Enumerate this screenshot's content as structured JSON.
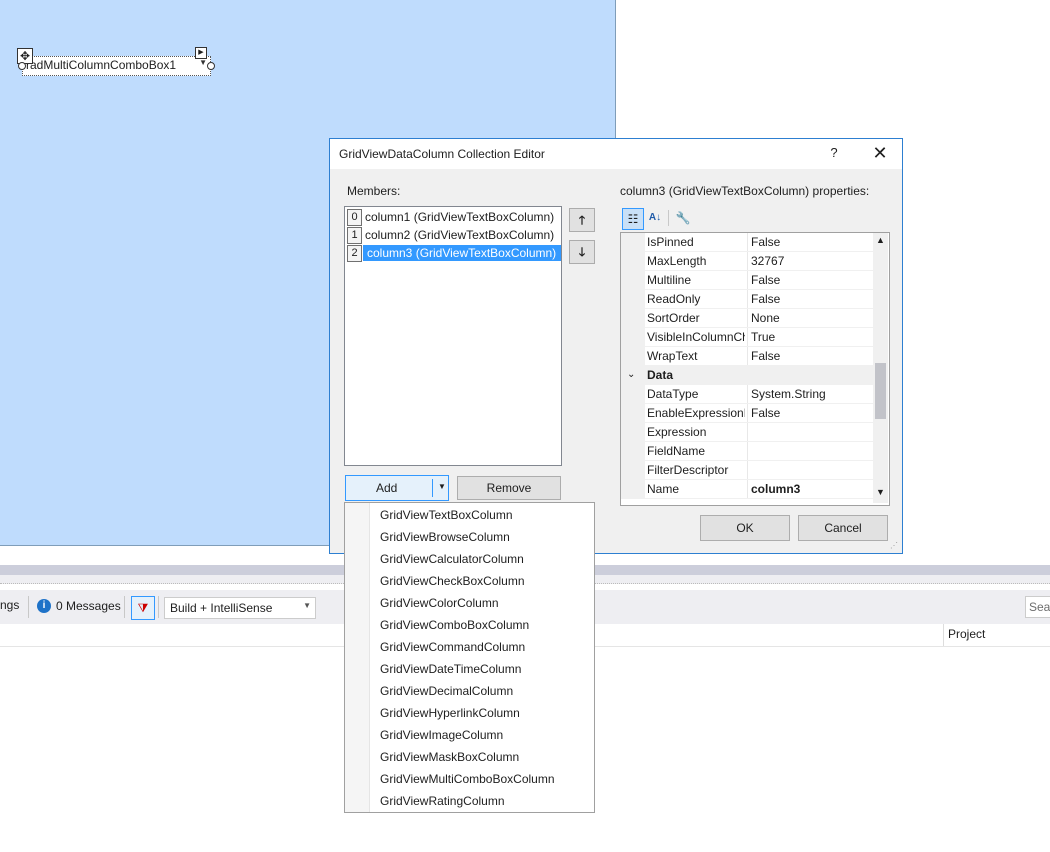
{
  "designer": {
    "combo_text": "radMultiColumnComboBox1"
  },
  "output_panel": {
    "warnings_tail": "ngs",
    "messages": "0 Messages",
    "build_filter": "Build + IntelliSense",
    "search_placeholder": "Sear",
    "column_project": "Project"
  },
  "dialog": {
    "title": "GridViewDataColumn Collection Editor",
    "help": "?",
    "close": "✕",
    "members_label": "Members:",
    "members": [
      {
        "index": "0",
        "text": "column1 (GridViewTextBoxColumn)"
      },
      {
        "index": "1",
        "text": "column2 (GridViewTextBoxColumn)"
      },
      {
        "index": "2",
        "text": "column3 (GridViewTextBoxColumn)"
      }
    ],
    "selected_member_index": 2,
    "add_label": "Add",
    "remove_label": "Remove",
    "properties_label": "column3 (GridViewTextBoxColumn) properties:",
    "properties": [
      {
        "name": "IsPinned",
        "value": "False"
      },
      {
        "name": "MaxLength",
        "value": "32767"
      },
      {
        "name": "Multiline",
        "value": "False"
      },
      {
        "name": "ReadOnly",
        "value": "False"
      },
      {
        "name": "SortOrder",
        "value": "None"
      },
      {
        "name": "VisibleInColumnCh",
        "value": "True"
      },
      {
        "name": "WrapText",
        "value": "False"
      },
      {
        "category": "Data"
      },
      {
        "name": "DataType",
        "value": "System.String"
      },
      {
        "name": "EnableExpressionEd",
        "value": "False"
      },
      {
        "name": "Expression",
        "value": ""
      },
      {
        "name": "FieldName",
        "value": ""
      },
      {
        "name": "FilterDescriptor",
        "value": ""
      },
      {
        "name": "Name",
        "value": "column3"
      }
    ],
    "ok_label": "OK",
    "cancel_label": "Cancel"
  },
  "add_dropdown": {
    "items": [
      "GridViewTextBoxColumn",
      "GridViewBrowseColumn",
      "GridViewCalculatorColumn",
      "GridViewCheckBoxColumn",
      "GridViewColorColumn",
      "GridViewComboBoxColumn",
      "GridViewCommandColumn",
      "GridViewDateTimeColumn",
      "GridViewDecimalColumn",
      "GridViewHyperlinkColumn",
      "GridViewImageColumn",
      "GridViewMaskBoxColumn",
      "GridViewMultiComboBoxColumn",
      "GridViewRatingColumn"
    ]
  },
  "colors": {
    "designer_bg": "#bfdcfd",
    "selection": "#3399ff",
    "accent_border": "#2d7fd1"
  }
}
